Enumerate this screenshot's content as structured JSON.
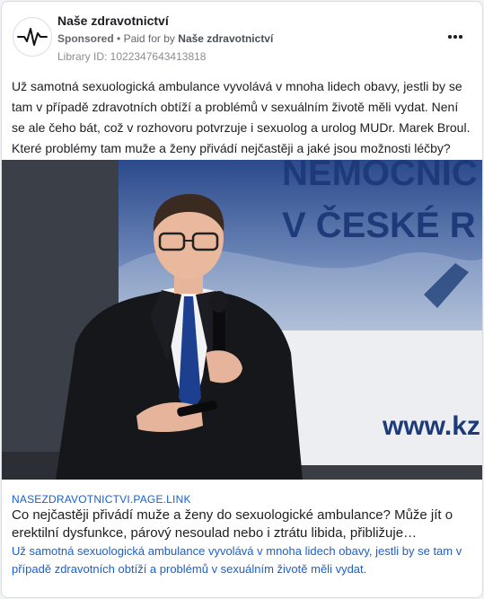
{
  "post": {
    "page_name": "Naše zdravotnictví",
    "sponsored_label": "Sponsored",
    "paid_for_prefix": "Paid for by",
    "paid_for_name": "Naše zdravotnictví",
    "library_id": "Library ID: 1022347643413818",
    "avatar_icon": "heartbeat-pulse-icon",
    "more_icon": "more-options-icon",
    "body_text": "Už samotná sexuologická ambulance vyvolává v mnoha lidech obavy, jestli by se tam v případě zdravotních obtíží a problémů v sexuálním životě měli vydat. Není se ale čeho bát, což v rozhovoru potvrzuje i sexuolog a urolog MUDr. Marek Broul. Které problémy tam muže a ženy přivádí nejčastěji a jaké jsou možnosti léčby?"
  },
  "media": {
    "banner_line1": "NEMOCNIC",
    "banner_line2": "V ČESKÉ R",
    "banner_url": "www.kz"
  },
  "link": {
    "domain": "NASEZDRAVOTNICTVI.PAGE.LINK",
    "headline": "Co nejčastěji přivádí muže a ženy do sexuologické ambulance? Může jít o erektilní dysfunkce, párový nesoulad nebo i ztrátu libida, přibližuje…",
    "description": "Už samotná sexuologická ambulance vyvolává v mnoha lidech obavy, jestli by se tam v případě zdravotních obtíží a problémů v sexuálním životě měli vydat."
  },
  "colors": {
    "link_blue": "#1a5fd1",
    "banner_blue": "#1e3a78"
  }
}
